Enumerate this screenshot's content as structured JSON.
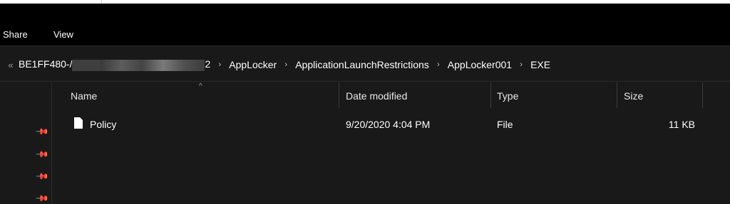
{
  "ribbon": {
    "tabs": [
      {
        "label": "Share"
      },
      {
        "label": "View"
      }
    ]
  },
  "address": {
    "overflow": "«",
    "root_visible": "BE1FF480-/",
    "root_tail_visible": "2",
    "segments": [
      "AppLocker",
      "ApplicationLaunchRestrictions",
      "AppLocker001",
      "EXE"
    ],
    "separator": "›"
  },
  "columns": [
    {
      "label": "Name"
    },
    {
      "label": "Date modified"
    },
    {
      "label": "Type"
    },
    {
      "label": "Size"
    }
  ],
  "sort_indicator": "^",
  "files": [
    {
      "name": "Policy",
      "date_modified": "9/20/2020 4:04 PM",
      "type": "File",
      "size": "11 KB",
      "icon": "file-icon"
    }
  ],
  "quick_access_pins": 4
}
